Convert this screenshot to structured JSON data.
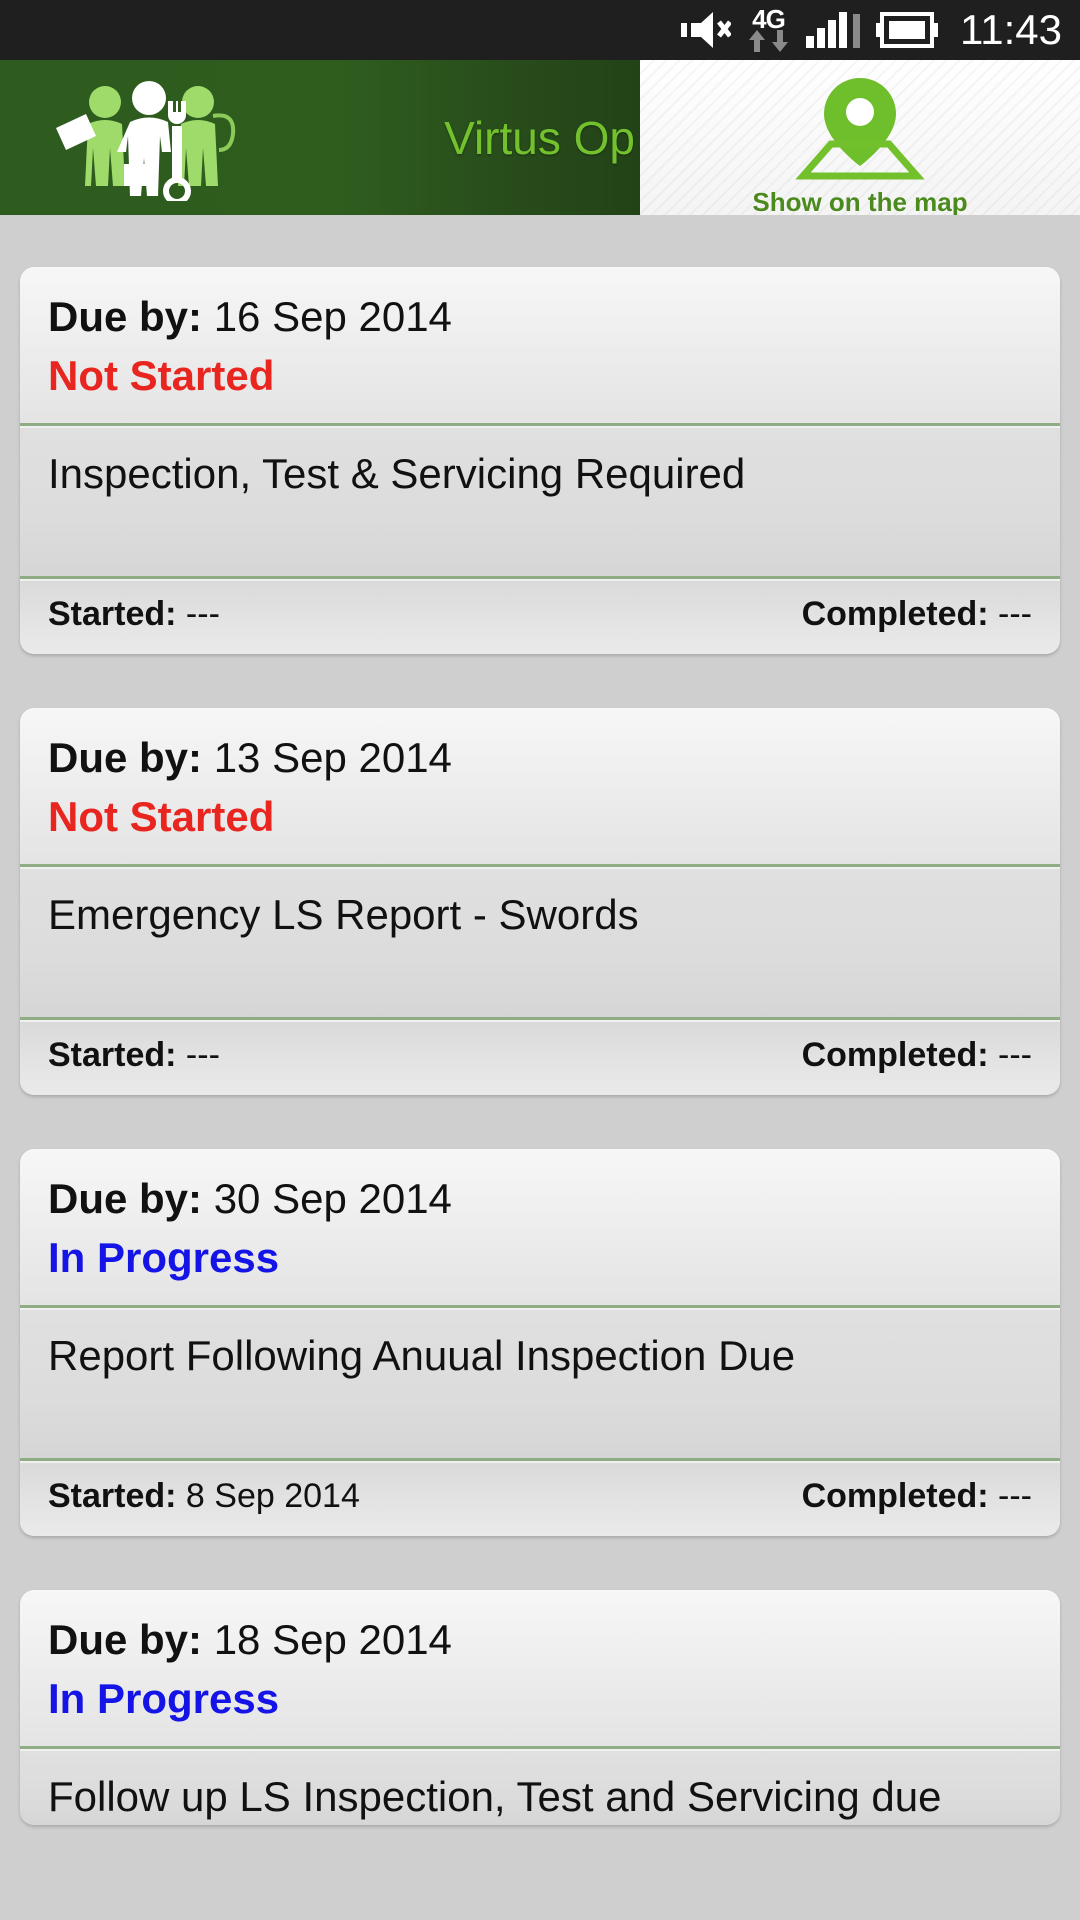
{
  "statusbar": {
    "time": "11:43",
    "network_type": "4G",
    "icons": [
      "volume-mute-icon",
      "data-transfer-icon",
      "signal-bars-icon",
      "battery-icon"
    ]
  },
  "header": {
    "title": "Virtus Op",
    "logo_name": "workers-tools-logo",
    "map_button_label": "Show on the map",
    "map_icon": "map-pin-icon",
    "accent_green": "#74c12e",
    "bar_green": "#2e5c1e"
  },
  "labels": {
    "due_by": "Due by:",
    "started": "Started:",
    "completed": "Completed:"
  },
  "status_colors": {
    "not_started": "#e8251f",
    "in_progress": "#1414e6"
  },
  "tasks": [
    {
      "due_date": "16 Sep 2014",
      "status": "Not Started",
      "status_key": "not_started",
      "description": "Inspection, Test & Servicing Required",
      "started": "---",
      "completed": "---"
    },
    {
      "due_date": "13 Sep 2014",
      "status": "Not Started",
      "status_key": "not_started",
      "description": "Emergency LS Report - Swords",
      "started": "---",
      "completed": "---"
    },
    {
      "due_date": "30 Sep 2014",
      "status": "In Progress",
      "status_key": "in_progress",
      "description": "Report Following Anuual Inspection Due",
      "started": "8 Sep 2014",
      "completed": "---"
    },
    {
      "due_date": "18 Sep 2014",
      "status": "In Progress",
      "status_key": "in_progress",
      "description": "Follow up LS Inspection, Test and Servicing due",
      "started": "",
      "completed": ""
    }
  ]
}
